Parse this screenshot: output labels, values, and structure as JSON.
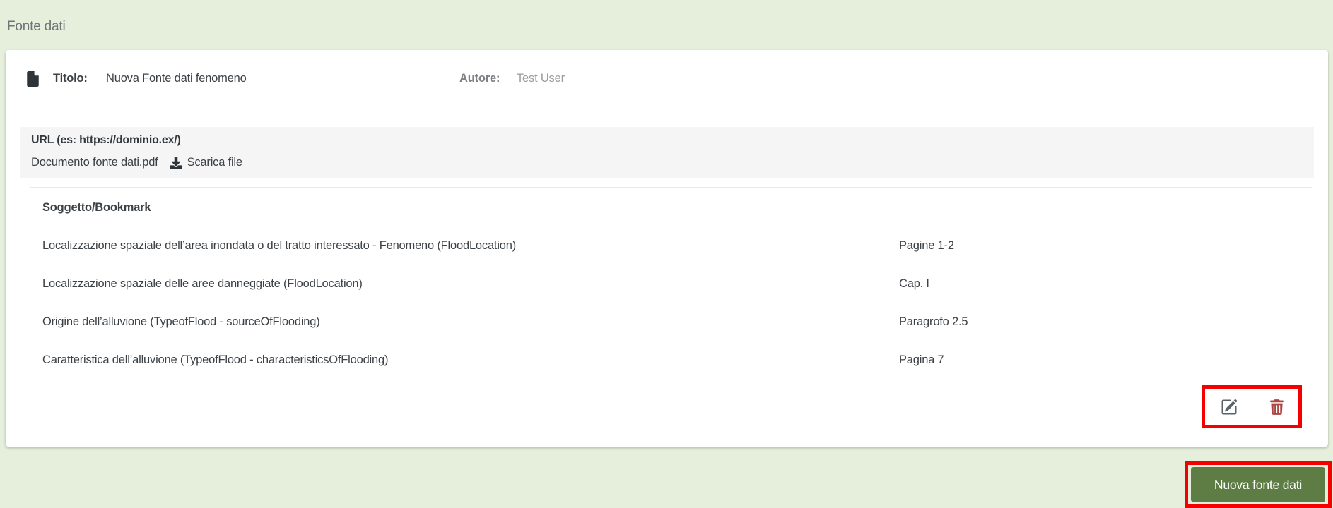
{
  "page": {
    "title": "Fonte dati"
  },
  "card": {
    "titolo_label": "Titolo:",
    "titolo_value": "Nuova Fonte dati fenomeno",
    "autore_label": "Autore:",
    "autore_value": "Test User",
    "url_label": "URL (es: https://dominio.ex/)",
    "document_name": "Documento fonte dati.pdf",
    "download_label": "Scarica file",
    "table": {
      "header": "Soggetto/Bookmark",
      "rows": [
        {
          "subject": "Localizzazione spaziale dell’area inondata o del tratto interessato - Fenomeno (FloodLocation)",
          "pages": "Pagine 1-2"
        },
        {
          "subject": "Localizzazione spaziale delle aree danneggiate (FloodLocation)",
          "pages": "Cap. I"
        },
        {
          "subject": "Origine dell’alluvione (TypeofFlood - sourceOfFlooding)",
          "pages": "Paragrofo 2.5"
        },
        {
          "subject": "Caratteristica dell’alluvione (TypeofFlood - characteristicsOfFlooding)",
          "pages": "Pagina 7"
        }
      ]
    },
    "icons": {
      "title": "file-icon",
      "download": "download-icon",
      "edit": "edit-pencil-icon",
      "delete": "trash-icon"
    }
  },
  "footer": {
    "new_button_label": "Nuova fonte dati"
  },
  "colors": {
    "background_green": "#e6efdc",
    "button_green": "#5e7d45",
    "annotation_red": "#f50000",
    "delete_red": "#ab4742",
    "edit_gray": "#5a636b",
    "url_bar_gray": "#f5f5f6"
  }
}
